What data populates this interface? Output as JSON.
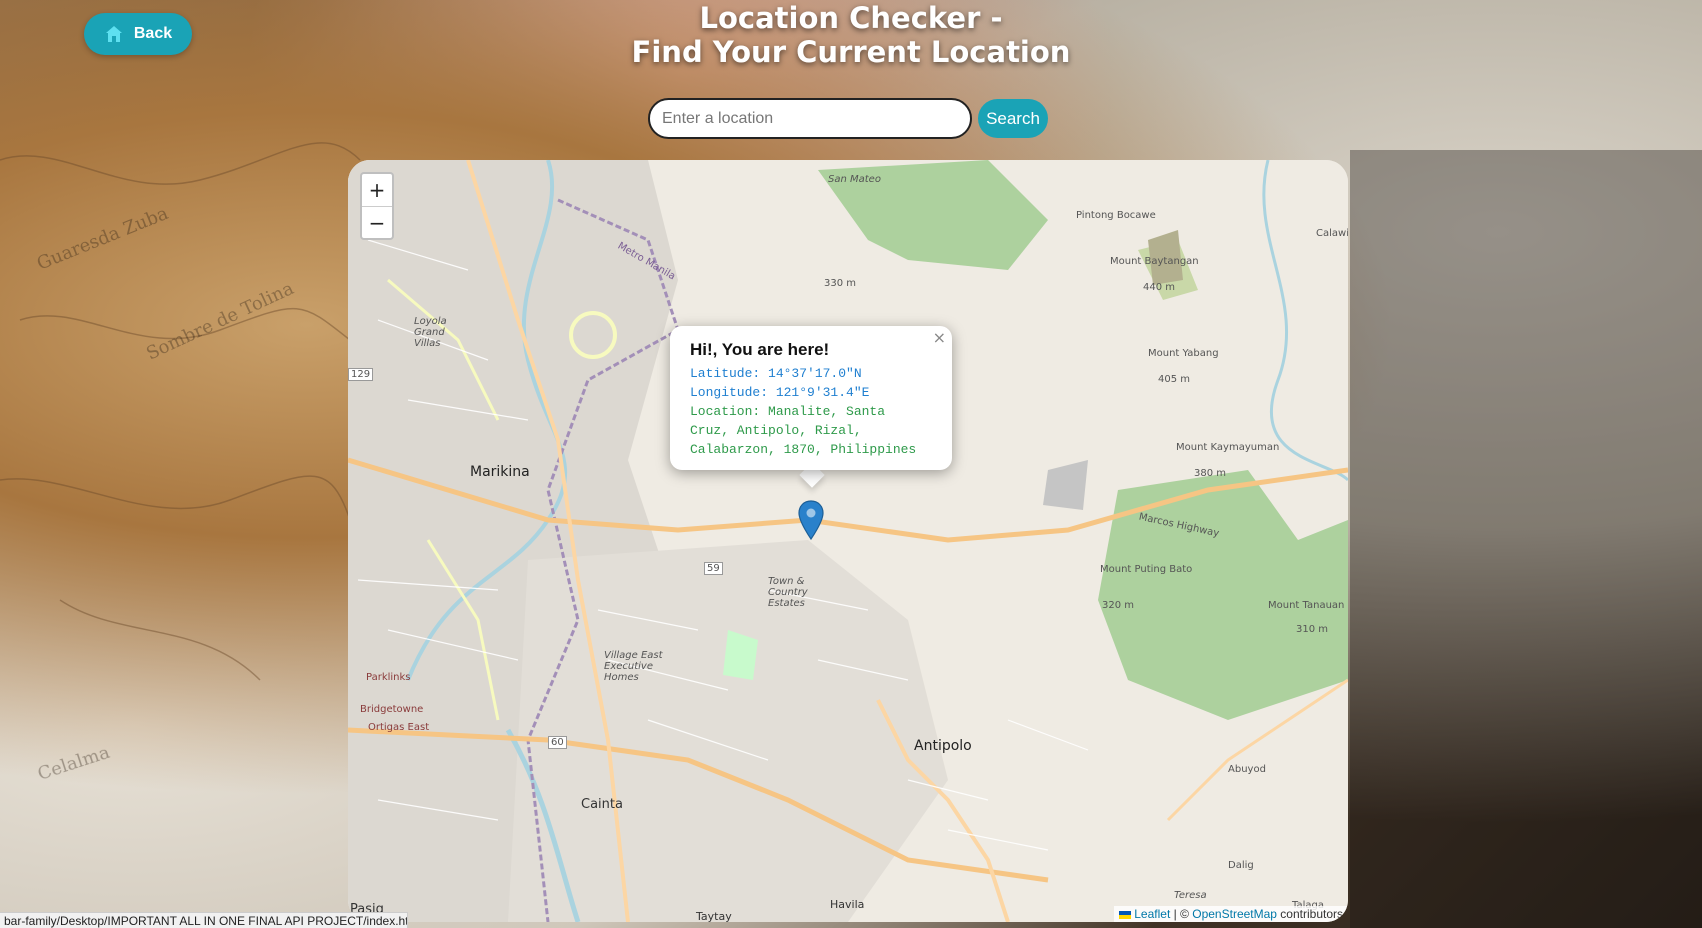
{
  "header": {
    "back_label": "Back",
    "title_line1": "Location Checker -",
    "title_line2": "Find Your Current Location"
  },
  "search": {
    "placeholder": "Enter a location",
    "value": "",
    "button_label": "Search"
  },
  "map": {
    "zoom_in": "+",
    "zoom_out": "−",
    "popup": {
      "close": "×",
      "heading": "Hi!, You are here!",
      "latitude": "Latitude: 14°37'17.0\"N",
      "longitude": "Longitude: 121°9'31.4\"E",
      "location_line1": "Location: Manalite, Santa",
      "location_line2": "Cruz, Antipolo, Rizal,",
      "location_line3": "Calabarzon, 1870, Philippines"
    },
    "labels": {
      "marikina": "Marikina",
      "antipolo": "Antipolo",
      "cainta": "Cainta",
      "pasig": "Pasig",
      "taytay": "Taytay",
      "havila": "Havila",
      "abuyod": "Abuyod",
      "dalig": "Dalig",
      "pintong_bocawe": "Pintong Bocawe",
      "san_mateo": "San Mateo",
      "calawis": "Calawi",
      "mount_baytangan": "Mount Baytangan",
      "mount_baytangan_elev": "440 m",
      "mount_yabang": "Mount Yabang",
      "mount_yabang_elev": "405 m",
      "mount_kaymayuman": "Mount Kaymayuman",
      "mount_kaymayuman_elev": "380 m",
      "mount_puting_bato": "Mount Puting Bato",
      "mount_puting_bato_elev": "320 m",
      "mount_tanauan": "Mount Tanauan",
      "mount_tanauan_elev": "310 m",
      "elev_330": "330 m",
      "town_country": "Town & Country Estates",
      "village_east": "Village East Executive Homes",
      "marcos_highway": "Marcos Highway",
      "road_59": "59",
      "road_60": "60",
      "road_129": "129",
      "parklinks": "Parklinks",
      "bridgetowne": "Bridgetowne",
      "ortigas_east": "Ortigas East",
      "teresa": "Teresa",
      "talaga": "Talaga",
      "metro_manila": "Metro Manila",
      "loyola": "Loyola Grand Villas"
    },
    "attribution": {
      "leaflet": "Leaflet",
      "separator": " | © ",
      "osm": "OpenStreetMap",
      "contributors": " contributors"
    }
  },
  "status_bar": {
    "url_text": "bar-family/Desktop/IMPORTANT ALL IN ONE FINAL API PROJECT/index.html"
  },
  "colors": {
    "accent": "#1aa3b6",
    "marker": "#2a81cb",
    "popup_lat": "#1f7fd0",
    "popup_loc": "#2e9a4a"
  }
}
